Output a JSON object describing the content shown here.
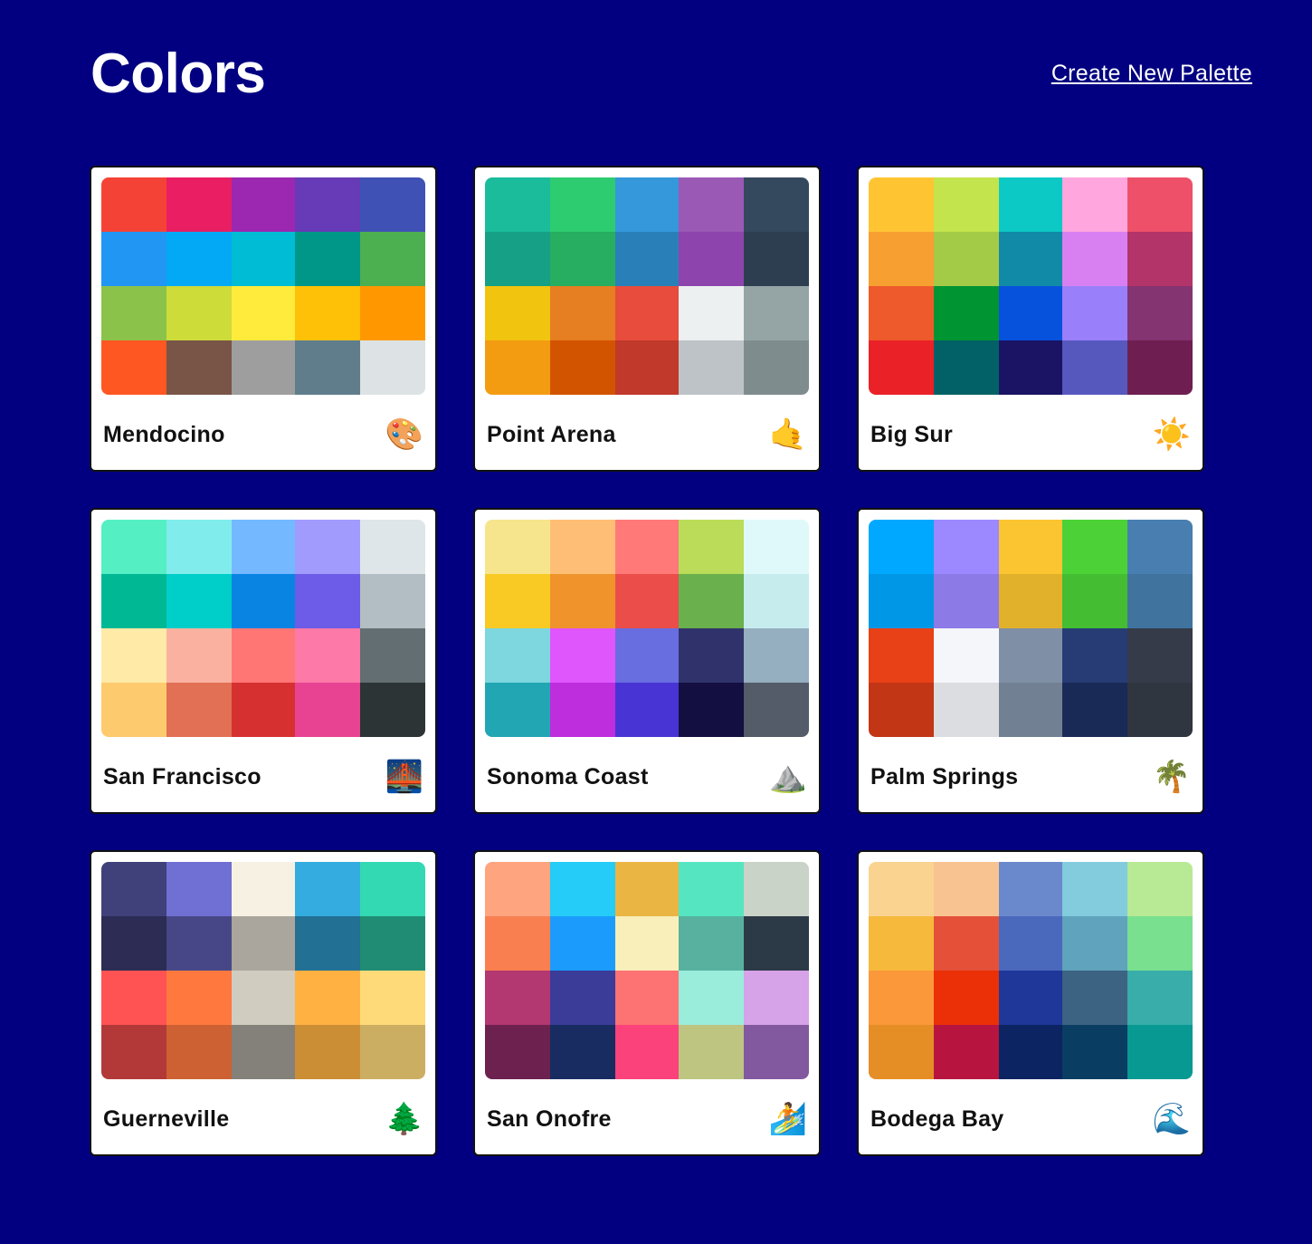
{
  "header": {
    "title": "Colors",
    "create_link": "Create New Palette"
  },
  "palettes": [
    {
      "name": "Mendocino",
      "emoji": "🎨",
      "icon": "artist-palette-icon",
      "colors": [
        "#f44336",
        "#e91e63",
        "#9c27b0",
        "#673ab7",
        "#3f51b5",
        "#2196f3",
        "#03a9f4",
        "#00bcd4",
        "#009688",
        "#4caf50",
        "#8bc34a",
        "#cddc39",
        "#ffeb3b",
        "#ffc107",
        "#ff9800",
        "#ff5722",
        "#795548",
        "#9e9e9e",
        "#607d8b",
        "#dde2e5"
      ]
    },
    {
      "name": "Point Arena",
      "emoji": "🤙",
      "icon": "call-me-hand-icon",
      "colors": [
        "#1abc9c",
        "#2ecc71",
        "#3498db",
        "#9b59b6",
        "#34495e",
        "#16a085",
        "#27ae60",
        "#2980b9",
        "#8e44ad",
        "#2c3e50",
        "#f1c40f",
        "#e67e22",
        "#e74c3c",
        "#ecf0f1",
        "#95a5a6",
        "#f39c12",
        "#d35400",
        "#c0392b",
        "#bdc3c7",
        "#7f8c8d"
      ]
    },
    {
      "name": "Big Sur",
      "emoji": "☀️",
      "icon": "sun-icon",
      "colors": [
        "#ffc432",
        "#c4e44d",
        "#0cc9c5",
        "#ffa6de",
        "#ee5069",
        "#f79f31",
        "#a3cb48",
        "#118aa8",
        "#d880f2",
        "#b33469",
        "#ee5a2b",
        "#009432",
        "#0652dd",
        "#9980fa",
        "#833471",
        "#ea2127",
        "#016166",
        "#1b1464",
        "#5758be",
        "#6f1e51"
      ]
    },
    {
      "name": "San Francisco",
      "emoji": "🌉",
      "icon": "bridge-at-night-icon",
      "colors": [
        "#55efc4",
        "#81ecec",
        "#74b9ff",
        "#a29bfe",
        "#dfe6e9",
        "#00b894",
        "#00cec9",
        "#0984e3",
        "#6c5ce7",
        "#b2bec3",
        "#ffeaa7",
        "#fab1a0",
        "#ff7675",
        "#fd79a8",
        "#636e72",
        "#fdcb6e",
        "#e17055",
        "#d63031",
        "#e84393",
        "#2d3436"
      ]
    },
    {
      "name": "Sonoma Coast",
      "emoji": "⛰️",
      "icon": "mountain-icon",
      "colors": [
        "#f6e58d",
        "#ffbe76",
        "#ff7979",
        "#badc58",
        "#dff9fb",
        "#f9ca24",
        "#f0932b",
        "#eb4d4b",
        "#6ab04c",
        "#c7ecee",
        "#7ed6df",
        "#e056fd",
        "#686de0",
        "#30336b",
        "#95afc0",
        "#22a6b3",
        "#be2edd",
        "#4834d4",
        "#130f40",
        "#535c68"
      ]
    },
    {
      "name": "Palm Springs",
      "emoji": "🌴",
      "icon": "palm-tree-icon",
      "colors": [
        "#00a8ff",
        "#9c88ff",
        "#fbc531",
        "#4cd137",
        "#487eb0",
        "#0097e6",
        "#8c7ae6",
        "#e1b12c",
        "#44bd32",
        "#40739e",
        "#e84118",
        "#f5f6fa",
        "#7f8fa6",
        "#273c75",
        "#353b48",
        "#c23616",
        "#dcdde1",
        "#718093",
        "#192a56",
        "#2f3640"
      ]
    },
    {
      "name": "Guerneville",
      "emoji": "🌲",
      "icon": "evergreen-tree-icon",
      "colors": [
        "#40407a",
        "#706fd3",
        "#f7f1e3",
        "#34ace0",
        "#33d9b2",
        "#2c2c54",
        "#474787",
        "#aaa69d",
        "#227093",
        "#218c74",
        "#ff5252",
        "#ff793f",
        "#d1ccc0",
        "#ffb142",
        "#ffda79",
        "#b33939",
        "#cd6133",
        "#84817a",
        "#cc8e35",
        "#ccae62"
      ]
    },
    {
      "name": "San Onofre",
      "emoji": "🏄",
      "icon": "surfer-icon",
      "colors": [
        "#fea47f",
        "#25ccf7",
        "#eab543",
        "#55e6c1",
        "#cad3c8",
        "#f97f51",
        "#1b9cfc",
        "#f8efba",
        "#58b19f",
        "#2c3a47",
        "#b33771",
        "#3b3b98",
        "#fd7272",
        "#9aecdb",
        "#d6a2e8",
        "#6d214f",
        "#182c61",
        "#fc427b",
        "#bdc581",
        "#82589f"
      ]
    },
    {
      "name": "Bodega Bay",
      "emoji": "🌊",
      "icon": "water-wave-icon",
      "colors": [
        "#fad390",
        "#f8c291",
        "#6a89cc",
        "#82ccdd",
        "#b8e994",
        "#f6b93b",
        "#e55039",
        "#4a69bd",
        "#60a3bc",
        "#78e08f",
        "#fa983a",
        "#eb2f06",
        "#1e3799",
        "#3c6382",
        "#38ada9",
        "#e58e26",
        "#b71540",
        "#0c2461",
        "#0a3d62",
        "#079992"
      ]
    }
  ]
}
